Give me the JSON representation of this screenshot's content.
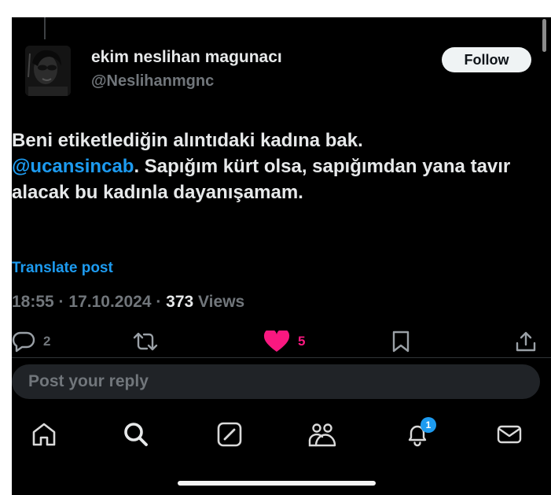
{
  "post": {
    "author_name": "ekim neslihan magunacı",
    "author_handle": "@Neslihanmgnc",
    "follow_label": "Follow",
    "text_part1": "Beni etiketlediğin alıntıdaki kadına bak.",
    "mention": "@ucansincab",
    "text_part2": ". Sapığım kürt olsa, sapığımdan yana tavır alacak bu kadınla dayanışamam.",
    "translate_label": "Translate post",
    "time": "18:55",
    "separator": " · ",
    "date": "17.10.2024",
    "views_count": "373",
    "views_label": " Views"
  },
  "actions": {
    "replies": "2",
    "retweets": "",
    "likes": "5",
    "liked": true,
    "like_color": "#f91880"
  },
  "reply_box": {
    "placeholder": "Post your reply"
  },
  "tabbar": {
    "items": [
      "home-icon",
      "search-icon",
      "grok-icon",
      "communities-icon",
      "notifications-icon",
      "messages-icon"
    ],
    "notification_badge": "1"
  },
  "colors": {
    "background": "#000000",
    "text": "#e7e9ea",
    "secondary": "#71767b",
    "accent": "#1d9bf0"
  }
}
